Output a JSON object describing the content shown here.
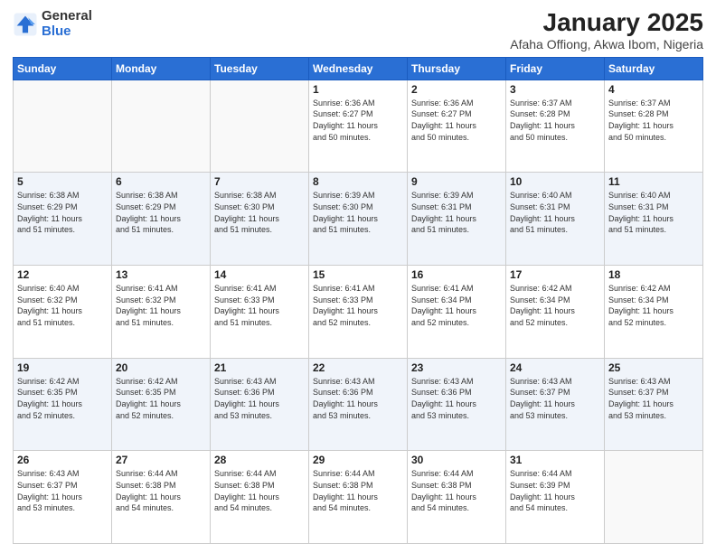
{
  "logo": {
    "general": "General",
    "blue": "Blue"
  },
  "title": "January 2025",
  "subtitle": "Afaha Offiong, Akwa Ibom, Nigeria",
  "days_of_week": [
    "Sunday",
    "Monday",
    "Tuesday",
    "Wednesday",
    "Thursday",
    "Friday",
    "Saturday"
  ],
  "weeks": [
    [
      {
        "day": "",
        "info": ""
      },
      {
        "day": "",
        "info": ""
      },
      {
        "day": "",
        "info": ""
      },
      {
        "day": "1",
        "info": "Sunrise: 6:36 AM\nSunset: 6:27 PM\nDaylight: 11 hours\nand 50 minutes."
      },
      {
        "day": "2",
        "info": "Sunrise: 6:36 AM\nSunset: 6:27 PM\nDaylight: 11 hours\nand 50 minutes."
      },
      {
        "day": "3",
        "info": "Sunrise: 6:37 AM\nSunset: 6:28 PM\nDaylight: 11 hours\nand 50 minutes."
      },
      {
        "day": "4",
        "info": "Sunrise: 6:37 AM\nSunset: 6:28 PM\nDaylight: 11 hours\nand 50 minutes."
      }
    ],
    [
      {
        "day": "5",
        "info": "Sunrise: 6:38 AM\nSunset: 6:29 PM\nDaylight: 11 hours\nand 51 minutes."
      },
      {
        "day": "6",
        "info": "Sunrise: 6:38 AM\nSunset: 6:29 PM\nDaylight: 11 hours\nand 51 minutes."
      },
      {
        "day": "7",
        "info": "Sunrise: 6:38 AM\nSunset: 6:30 PM\nDaylight: 11 hours\nand 51 minutes."
      },
      {
        "day": "8",
        "info": "Sunrise: 6:39 AM\nSunset: 6:30 PM\nDaylight: 11 hours\nand 51 minutes."
      },
      {
        "day": "9",
        "info": "Sunrise: 6:39 AM\nSunset: 6:31 PM\nDaylight: 11 hours\nand 51 minutes."
      },
      {
        "day": "10",
        "info": "Sunrise: 6:40 AM\nSunset: 6:31 PM\nDaylight: 11 hours\nand 51 minutes."
      },
      {
        "day": "11",
        "info": "Sunrise: 6:40 AM\nSunset: 6:31 PM\nDaylight: 11 hours\nand 51 minutes."
      }
    ],
    [
      {
        "day": "12",
        "info": "Sunrise: 6:40 AM\nSunset: 6:32 PM\nDaylight: 11 hours\nand 51 minutes."
      },
      {
        "day": "13",
        "info": "Sunrise: 6:41 AM\nSunset: 6:32 PM\nDaylight: 11 hours\nand 51 minutes."
      },
      {
        "day": "14",
        "info": "Sunrise: 6:41 AM\nSunset: 6:33 PM\nDaylight: 11 hours\nand 51 minutes."
      },
      {
        "day": "15",
        "info": "Sunrise: 6:41 AM\nSunset: 6:33 PM\nDaylight: 11 hours\nand 52 minutes."
      },
      {
        "day": "16",
        "info": "Sunrise: 6:41 AM\nSunset: 6:34 PM\nDaylight: 11 hours\nand 52 minutes."
      },
      {
        "day": "17",
        "info": "Sunrise: 6:42 AM\nSunset: 6:34 PM\nDaylight: 11 hours\nand 52 minutes."
      },
      {
        "day": "18",
        "info": "Sunrise: 6:42 AM\nSunset: 6:34 PM\nDaylight: 11 hours\nand 52 minutes."
      }
    ],
    [
      {
        "day": "19",
        "info": "Sunrise: 6:42 AM\nSunset: 6:35 PM\nDaylight: 11 hours\nand 52 minutes."
      },
      {
        "day": "20",
        "info": "Sunrise: 6:42 AM\nSunset: 6:35 PM\nDaylight: 11 hours\nand 52 minutes."
      },
      {
        "day": "21",
        "info": "Sunrise: 6:43 AM\nSunset: 6:36 PM\nDaylight: 11 hours\nand 53 minutes."
      },
      {
        "day": "22",
        "info": "Sunrise: 6:43 AM\nSunset: 6:36 PM\nDaylight: 11 hours\nand 53 minutes."
      },
      {
        "day": "23",
        "info": "Sunrise: 6:43 AM\nSunset: 6:36 PM\nDaylight: 11 hours\nand 53 minutes."
      },
      {
        "day": "24",
        "info": "Sunrise: 6:43 AM\nSunset: 6:37 PM\nDaylight: 11 hours\nand 53 minutes."
      },
      {
        "day": "25",
        "info": "Sunrise: 6:43 AM\nSunset: 6:37 PM\nDaylight: 11 hours\nand 53 minutes."
      }
    ],
    [
      {
        "day": "26",
        "info": "Sunrise: 6:43 AM\nSunset: 6:37 PM\nDaylight: 11 hours\nand 53 minutes."
      },
      {
        "day": "27",
        "info": "Sunrise: 6:44 AM\nSunset: 6:38 PM\nDaylight: 11 hours\nand 54 minutes."
      },
      {
        "day": "28",
        "info": "Sunrise: 6:44 AM\nSunset: 6:38 PM\nDaylight: 11 hours\nand 54 minutes."
      },
      {
        "day": "29",
        "info": "Sunrise: 6:44 AM\nSunset: 6:38 PM\nDaylight: 11 hours\nand 54 minutes."
      },
      {
        "day": "30",
        "info": "Sunrise: 6:44 AM\nSunset: 6:38 PM\nDaylight: 11 hours\nand 54 minutes."
      },
      {
        "day": "31",
        "info": "Sunrise: 6:44 AM\nSunset: 6:39 PM\nDaylight: 11 hours\nand 54 minutes."
      },
      {
        "day": "",
        "info": ""
      }
    ]
  ]
}
